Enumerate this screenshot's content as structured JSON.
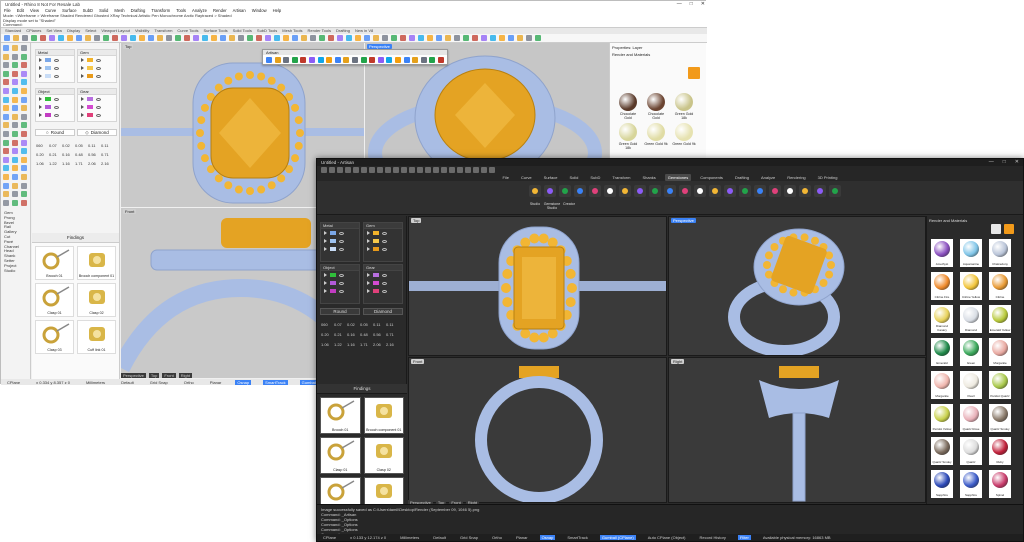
{
  "win1": {
    "title": "Untitled - Rhino 8 Not For Resale Lab",
    "menu": [
      "File",
      "Edit",
      "View",
      "Curve",
      "Surface",
      "SubD",
      "Solid",
      "Mesh",
      "Drafting",
      "Transform",
      "Tools",
      "Analyze",
      "Render",
      "Artisan",
      "Window",
      "Help"
    ],
    "command_history": [
      "Mode: <Wireframe > Wireframe  Shaded  Rendered  Ghosted  XRay  Technical  Artistic  Pen  Monochrome  Arctic  Raytraced > Shaded",
      "Display mode set to \"Shaded\"",
      "Command:"
    ],
    "tabs": [
      "Standard",
      "CPlanes",
      "Set View",
      "Display",
      "Select",
      "Viewport Layout",
      "Visibility",
      "Transform",
      "Curve Tools",
      "Surface Tools",
      "Solid Tools",
      "SubD Tools",
      "Mesh Tools",
      "Render Tools",
      "Drafting",
      "New in V8"
    ],
    "material_groups": [
      {
        "name": "Metal",
        "colors": [
          "#7aa7e8",
          "#9ec3f0",
          "#c8dcf6"
        ]
      },
      {
        "name": "Gem",
        "colors": [
          "#f2b32a",
          "#f6c84a",
          "#e89a1a"
        ]
      },
      {
        "name": "Object",
        "colors": [
          "#2fbf3a",
          "#b25ad8",
          "#c23cc2"
        ]
      },
      {
        "name": "Gear",
        "colors": [
          "#b86fe0",
          "#d44bd0",
          "#e0407a"
        ]
      }
    ],
    "buttons": {
      "round": "Round",
      "diamond": "Diamond"
    },
    "numbers": [
      [
        "060",
        "0.07",
        "0.02",
        "0.05",
        "0.11",
        "0.11"
      ],
      [
        "0.20",
        "0.21",
        "0.16",
        "0.48",
        "0.56",
        "0.71"
      ],
      [
        "1.06",
        "1.22",
        "1.16",
        "1.71",
        "2.06",
        "2.16"
      ]
    ],
    "findings_title": "Findings",
    "findings": [
      "Brooch 01",
      "Brooch component 01",
      "Clasp 01",
      "Clasp 02",
      "Clasp 03",
      "Cuff link 01"
    ],
    "left_list": [
      "Gem",
      "Prong",
      "Bezel",
      "Rail",
      "Gallery",
      "Cut",
      "Pavé",
      "Channel",
      "Head",
      "Shank",
      "Setter",
      "Project",
      "Studio"
    ],
    "viewports": [
      {
        "label": "Top"
      },
      {
        "label": "Perspective"
      },
      {
        "label": "Front"
      },
      {
        "label": "Right"
      }
    ],
    "vp_tabs": [
      "Perspective",
      "Top",
      "Front",
      "Right"
    ],
    "right_panel_title": "Properties: Layer",
    "right_panel_sub": "Render and Materials",
    "gems": [
      {
        "name": "Chocolate Gold",
        "color": "#5a3a2a"
      },
      {
        "name": "Chocolate Gold",
        "color": "#6b4431"
      },
      {
        "name": "Green Gold 18k",
        "color": "#c9c48a"
      },
      {
        "name": "Green Gold 18k",
        "color": "#d7d59a"
      },
      {
        "name": "Green Gold 9k",
        "color": "#e0dca4"
      },
      {
        "name": "Green Gold 9k",
        "color": "#e6e2b0"
      }
    ],
    "status": [
      "CPlane",
      "x 0.334  y 8.357  z 0",
      "Millimeters",
      "Default",
      "Grid Snap",
      "Ortho",
      "Planar",
      "Osnap",
      "SmartTrack",
      "Gumball (CPlane)",
      "Auto CPlane (Object)",
      "Record History",
      "Filter"
    ],
    "status_on": [
      "Osnap",
      "SmartTrack",
      "Gumball (CPlane)"
    ]
  },
  "artisan_toolbar": {
    "title": "Artisan"
  },
  "win2": {
    "title": "Untitled - Artisan",
    "tabs": [
      "File",
      "Curve",
      "Surface",
      "Solid",
      "SubD",
      "Transform",
      "Shanks",
      "Gemstones",
      "Components",
      "Drafting",
      "Analyze",
      "Rendering",
      "3D Printing"
    ],
    "active_tab": "Gemstones",
    "ribbon_labels": [
      "Studio",
      "Gemstone Studio",
      "Creator"
    ],
    "material_groups": [
      {
        "name": "Metal",
        "colors": [
          "#7aa7e8",
          "#9ec3f0",
          "#c8dcf6"
        ]
      },
      {
        "name": "Gem",
        "colors": [
          "#f2b32a",
          "#f6c84a",
          "#e89a1a"
        ]
      },
      {
        "name": "Object",
        "colors": [
          "#2fbf3a",
          "#b25ad8",
          "#c23cc2"
        ]
      },
      {
        "name": "Gear",
        "colors": [
          "#b86fe0",
          "#d44bd0",
          "#e0407a"
        ]
      }
    ],
    "buttons": {
      "round": "Round",
      "diamond": "Diamond"
    },
    "numbers": [
      [
        "060",
        "0.07",
        "0.02",
        "0.05",
        "0.11",
        "0.11"
      ],
      [
        "0.20",
        "0.21",
        "0.16",
        "0.48",
        "0.56",
        "0.71"
      ],
      [
        "1.06",
        "1.22",
        "1.16",
        "1.71",
        "2.06",
        "2.16"
      ]
    ],
    "findings_title": "Findings",
    "findings": [
      "Brooch 01",
      "Brooch component 01",
      "Clasp 01",
      "Clasp 02",
      "Clasp 03",
      "Cuff link 01"
    ],
    "viewports": [
      {
        "label": "Top"
      },
      {
        "label": "Perspective"
      },
      {
        "label": "Front"
      },
      {
        "label": "Right"
      }
    ],
    "vp_tabs": [
      "Perspective",
      "Top",
      "Front",
      "Right"
    ],
    "right_panel_title": "Render and Materials",
    "gems": [
      {
        "name": "Amethyst",
        "color": "#8a4fc0"
      },
      {
        "name": "Aquamarine",
        "color": "#7fc5e8"
      },
      {
        "name": "Chalcedony",
        "color": "#b9c4d8"
      },
      {
        "name": "Citrine Fire",
        "color": "#f08a2a"
      },
      {
        "name": "Citrine Yellow",
        "color": "#f2c53a"
      },
      {
        "name": "Citrine",
        "color": "#e89a34"
      },
      {
        "name": "Diamond Canary",
        "color": "#e8d25a"
      },
      {
        "name": "Diamond",
        "color": "#d8dde4"
      },
      {
        "name": "Emerald Yellow",
        "color": "#b8c93a"
      },
      {
        "name": "Emerald",
        "color": "#1f8a4a"
      },
      {
        "name": "Green",
        "color": "#3aa85a"
      },
      {
        "name": "Morganite",
        "color": "#e8a8a0"
      },
      {
        "name": "Morganite",
        "color": "#f0b6ae"
      },
      {
        "name": "Pearl",
        "color": "#eeeae0"
      },
      {
        "name": "Peridot Quartz",
        "color": "#a8c84a"
      },
      {
        "name": "Peridot Yellow",
        "color": "#c8d04a"
      },
      {
        "name": "Quartz Rose",
        "color": "#e8b0b8"
      },
      {
        "name": "Quartz Smoky",
        "color": "#8a7a6a"
      },
      {
        "name": "Quartz Smoky",
        "color": "#7a6a5c"
      },
      {
        "name": "Quartz",
        "color": "#dcdcdc"
      },
      {
        "name": "Ruby",
        "color": "#c0203a"
      },
      {
        "name": "Sapphire",
        "color": "#2a48b8"
      },
      {
        "name": "Sapphire",
        "color": "#3a5ac8"
      },
      {
        "name": "Spinel",
        "color": "#c83a6a"
      }
    ],
    "command_lines": [
      "Image successfully saved as C:\\Users\\tamil\\Desktop\\Render (September 09, 1046 5).png",
      "Command: _Artisan",
      "Command: _Options",
      "Command: _Options",
      "Command: _Options",
      "Command:"
    ],
    "status": [
      "CPlane",
      "x 0.133  y 12.174  z 0",
      "Millimeters",
      "Default",
      "Grid Snap",
      "Ortho",
      "Planar",
      "Osnap",
      "SmartTrack",
      "Gumball (CPlane)",
      "Auto CPlane (Object)",
      "Record History",
      "Filter",
      "Available physical memory: 16863 MB"
    ],
    "status_on": [
      "Osnap",
      "Gumball (CPlane)",
      "Filter"
    ]
  }
}
